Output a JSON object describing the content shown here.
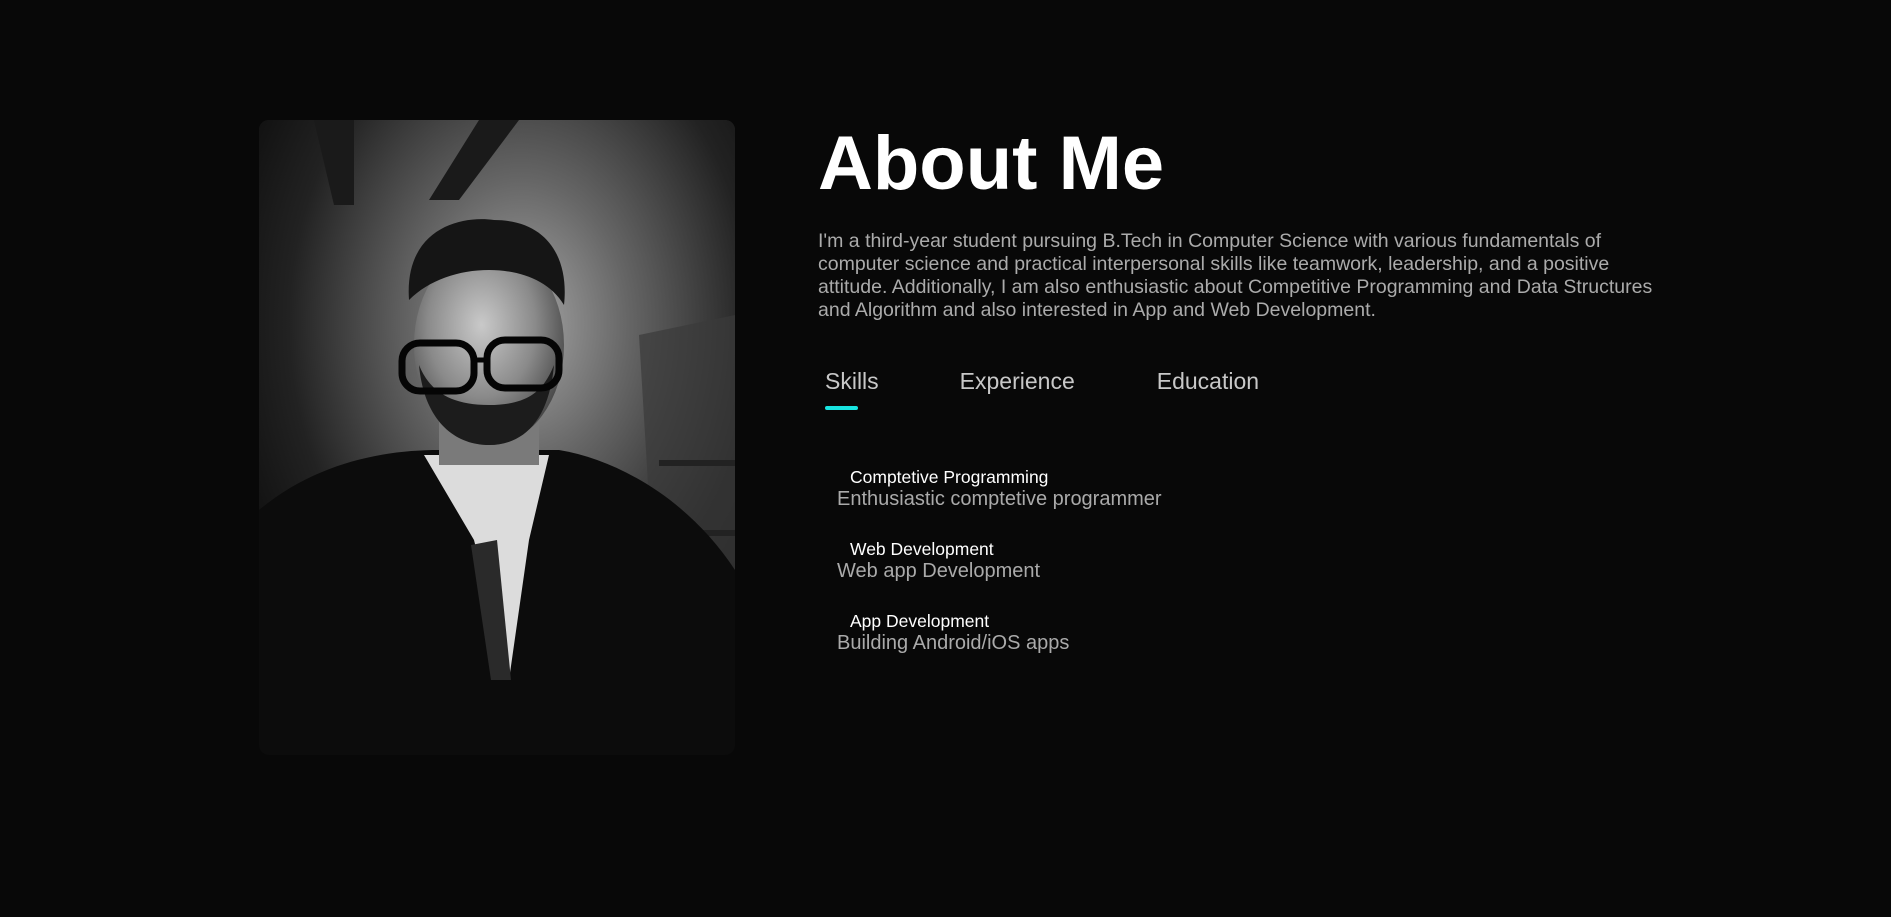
{
  "about": {
    "title": "About Me",
    "intro": "I'm a third-year student pursuing B.Tech in Computer Science with various fundamentals of computer science and practical interpersonal skills like teamwork, leadership, and a positive attitude. Additionally, I am also enthusiastic about Competitive Programming and Data Structures and Algorithm and also interested in App and Web Development."
  },
  "tabs": [
    {
      "label": "Skills",
      "active": true
    },
    {
      "label": "Experience",
      "active": false
    },
    {
      "label": "Education",
      "active": false
    }
  ],
  "skills": [
    {
      "name": "Comptetive Programming",
      "description": "Enthusiastic comptetive programmer"
    },
    {
      "name": "Web Development",
      "description": "Web app Development"
    },
    {
      "name": "App Development",
      "description": "Building Android/iOS apps"
    }
  ],
  "colors": {
    "background": "#080808",
    "accent": "#18e4e0",
    "heading": "#ffffff",
    "body_text": "#ababab"
  }
}
